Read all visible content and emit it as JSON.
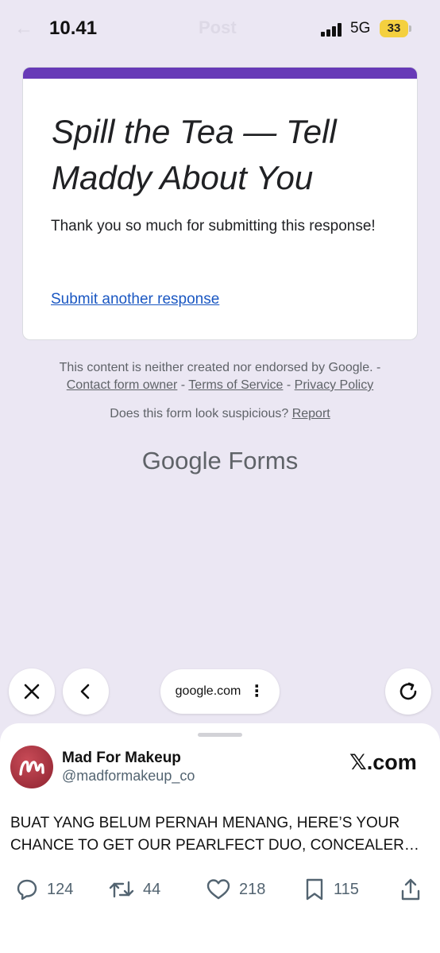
{
  "status_bar": {
    "time": "10.41",
    "network": "5G",
    "battery": "33",
    "ghost_title": "Post"
  },
  "form": {
    "title": "Spill the Tea — Tell Maddy About You",
    "message": "Thank you so much for submitting this response!",
    "submit_another": "Submit another response",
    "accent_color": "#673ab7"
  },
  "footer": {
    "disclaimer": "This content is neither created nor endorsed by Google. -",
    "contact": "Contact form owner",
    "terms": "Terms of Service",
    "privacy": "Privacy Policy",
    "separator": " - ",
    "suspicious": "Does this form look suspicious?",
    "report": "Report",
    "logo_google": "Google",
    "logo_forms": "Forms"
  },
  "browser": {
    "url": "google.com",
    "close_icon": "close-icon",
    "back_icon": "chevron-left-icon",
    "menu_icon": "more-vert-icon",
    "reload_icon": "reload-icon"
  },
  "post": {
    "author": "Mad For Makeup",
    "handle": "@madformakeup_co",
    "source": "𝕏.com",
    "text": "BUAT YANG BELUM PERNAH MENANG, HERE’S YOUR CHANCE TO GET OUR PEARLFECT DUO, CONCEALER AND LIP TINT",
    "replies": "124",
    "reposts": "44",
    "likes": "218",
    "bookmarks": "115"
  }
}
